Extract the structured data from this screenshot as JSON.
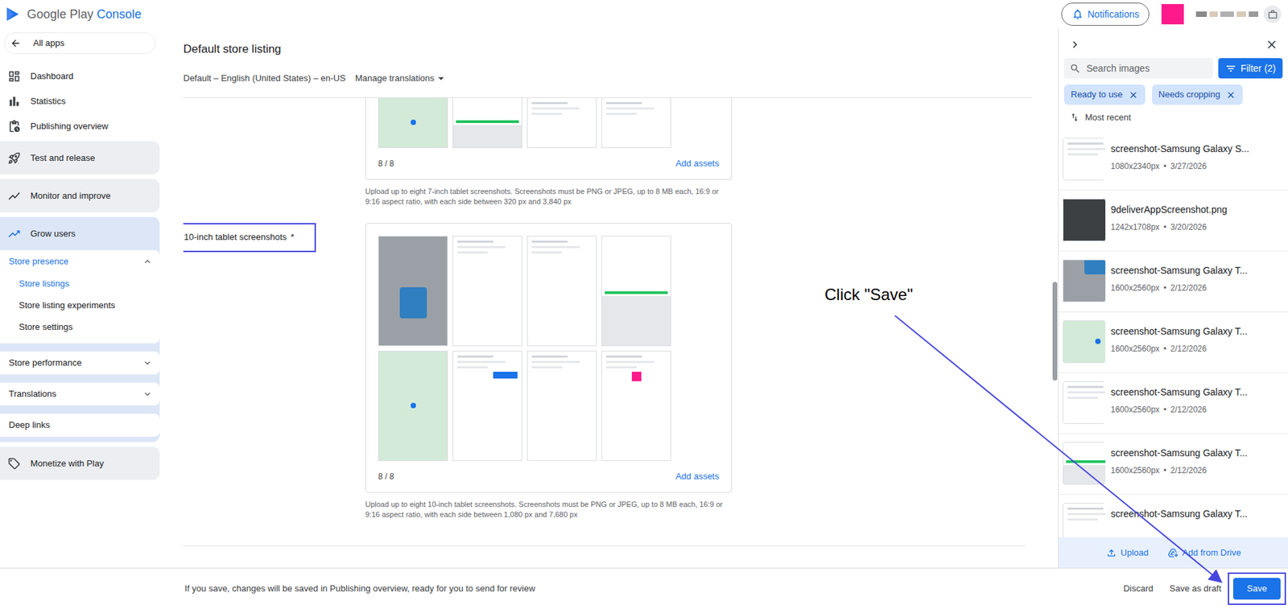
{
  "header": {
    "brand": "Google Play",
    "product": "Console",
    "notifications": "Notifications"
  },
  "sidebar": {
    "back": "All apps",
    "items": [
      {
        "label": "Dashboard",
        "kind": "link",
        "selected": false
      },
      {
        "label": "Statistics",
        "kind": "link",
        "selected": false
      },
      {
        "label": "Publishing overview",
        "kind": "link",
        "selected": false
      },
      {
        "label": "Test and release",
        "kind": "group",
        "selected": false,
        "expanded": false,
        "children": []
      },
      {
        "label": "Monitor and improve",
        "kind": "group",
        "selected": false,
        "expanded": false,
        "children": []
      },
      {
        "label": "Grow users",
        "kind": "group",
        "selected": true,
        "expanded": true,
        "children": [
          {
            "label": "Store presence",
            "selected": true,
            "expanded": true,
            "chevron": true,
            "children": [
              {
                "label": "Store listings",
                "selected": true
              },
              {
                "label": "Store listing experiments",
                "selected": false
              },
              {
                "label": "Store settings",
                "selected": false
              }
            ]
          },
          {
            "label": "Store performance",
            "selected": false,
            "expanded": false,
            "chevron": true,
            "children": []
          },
          {
            "label": "Translations",
            "selected": false,
            "expanded": false,
            "chevron": true,
            "children": []
          },
          {
            "label": "Deep links",
            "selected": false,
            "expanded": false,
            "chevron": false,
            "children": []
          }
        ]
      },
      {
        "label": "Monetize with Play",
        "kind": "group",
        "selected": false,
        "expanded": false,
        "children": []
      }
    ]
  },
  "page": {
    "title": "Default store listing",
    "language": "Default – English (United States) – en-US",
    "manage": "Manage translations"
  },
  "sections": [
    {
      "label": "",
      "required": "",
      "partial": true,
      "highlighted": false,
      "thumbnails": [
        {
          "kind": "map"
        },
        {
          "kind": "keypad"
        },
        {
          "kind": "screen"
        },
        {
          "kind": "screen"
        }
      ],
      "count": "8 / 8",
      "action": "Add assets",
      "help": "Upload up to eight 7-inch tablet screenshots. Screenshots must be PNG or JPEG, up to 8 MB each, 16:9 or 9:16 aspect ratio, with each side between 320 px and 3,840 px"
    },
    {
      "label": "10-inch tablet screenshots",
      "required": "*",
      "partial": false,
      "highlighted": true,
      "thumbnails": [
        {
          "kind": "photo"
        },
        {
          "kind": "screen"
        },
        {
          "kind": "screen"
        },
        {
          "kind": "keypad"
        },
        {
          "kind": "map"
        },
        {
          "kind": "chat"
        },
        {
          "kind": "screen"
        },
        {
          "kind": "profile"
        }
      ],
      "count": "8 / 8",
      "action": "Add assets",
      "help": "Upload up to eight 10-inch tablet screenshots. Screenshots must be PNG or JPEG, up to 8 MB each, 16:9 or 9:16 aspect ratio, with each side between 1,080 px and 7,680 px"
    }
  ],
  "panel": {
    "search": {
      "placeholder": "Search images"
    },
    "filter": "Filter (2)",
    "chips": [
      "Ready to use",
      "Needs cropping"
    ],
    "sort": "Most recent",
    "images": [
      {
        "name": "screenshot-Samsung Galaxy S...",
        "size": "1080x2340px",
        "date": "3/27/2026",
        "kind": "screen"
      },
      {
        "name": "9deliverAppScreenshot.png",
        "size": "1242x1708px",
        "date": "3/20/2026",
        "kind": "dark"
      },
      {
        "name": "screenshot-Samsung Galaxy T...",
        "size": "1600x2560px",
        "date": "2/12/2026",
        "kind": "photo"
      },
      {
        "name": "screenshot-Samsung Galaxy T...",
        "size": "1600x2560px",
        "date": "2/12/2026",
        "kind": "map"
      },
      {
        "name": "screenshot-Samsung Galaxy T...",
        "size": "1600x2560px",
        "date": "2/12/2026",
        "kind": "screen"
      },
      {
        "name": "screenshot-Samsung Galaxy T...",
        "size": "1600x2560px",
        "date": "2/12/2026",
        "kind": "keypad"
      },
      {
        "name": "screenshot-Samsung Galaxy T...",
        "size": "",
        "date": "",
        "kind": "screen"
      }
    ],
    "upload": "Upload",
    "drive": "Add from Drive"
  },
  "footer": {
    "message": "If you save, changes will be saved in Publishing overview, ready for you to send for review",
    "discard": "Discard",
    "draft": "Save as draft",
    "save": "Save",
    "save_highlighted": true
  },
  "annotation": {
    "text": "Click \"Save\""
  }
}
